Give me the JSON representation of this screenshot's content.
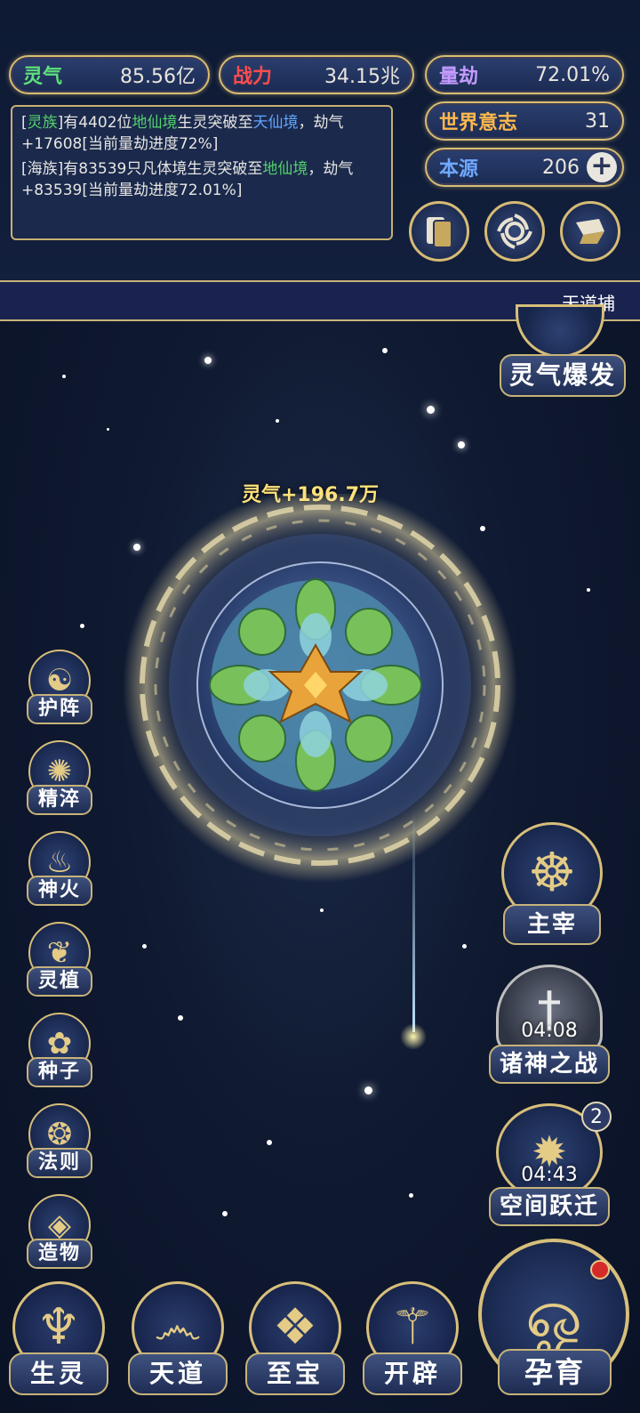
{
  "stats": {
    "lingqi": {
      "label": "灵气",
      "value": "85.56亿",
      "color": "#5ee07a"
    },
    "zhanli": {
      "label": "战力",
      "value": "34.15兆",
      "color": "#ff4d4d"
    },
    "liangjie": {
      "label": "量劫",
      "value": "72.01%",
      "color": "#c49bff"
    },
    "shijie": {
      "label": "世界意志",
      "value": "31",
      "color": "#ffb84d"
    },
    "benyuan": {
      "label": "本源",
      "value": "206",
      "color": "#6fa8ff"
    }
  },
  "log": {
    "line1": {
      "p1": "[",
      "p2": "灵族",
      "p3": "]有4402位",
      "p4": "地仙境",
      "p5": "生灵突破至",
      "p6": "天仙",
      "p7": "境",
      "p8": "，劫气+17608[当前量劫进度72%]"
    },
    "line2": {
      "p1": "[海族]有83539只凡体境生灵突破至",
      "p2": "地仙境",
      "p3": "，劫气+83539[当前量劫进度72.01%]"
    }
  },
  "banner": {
    "text": "天道捕"
  },
  "world": {
    "gain_text": "灵气+196.7万"
  },
  "left_menu": [
    "护阵",
    "精淬",
    "神火",
    "灵植",
    "种子",
    "法则",
    "造物"
  ],
  "right_menu": {
    "burst": {
      "label": "灵气爆发"
    },
    "master": {
      "label": "主宰"
    },
    "gods_war": {
      "label": "诸神之战",
      "timer": "04:08"
    },
    "space_jump": {
      "label": "空间跃迁",
      "timer": "04:43",
      "badge": "2"
    },
    "nurture": {
      "label": "孕育"
    }
  },
  "bottom_menu": [
    "生灵",
    "天道",
    "至宝",
    "开辟"
  ],
  "icons": {
    "add": "plus-icon",
    "cards": "cards-icon",
    "swirl": "swirl-icon",
    "scroll": "scroll-icon"
  }
}
